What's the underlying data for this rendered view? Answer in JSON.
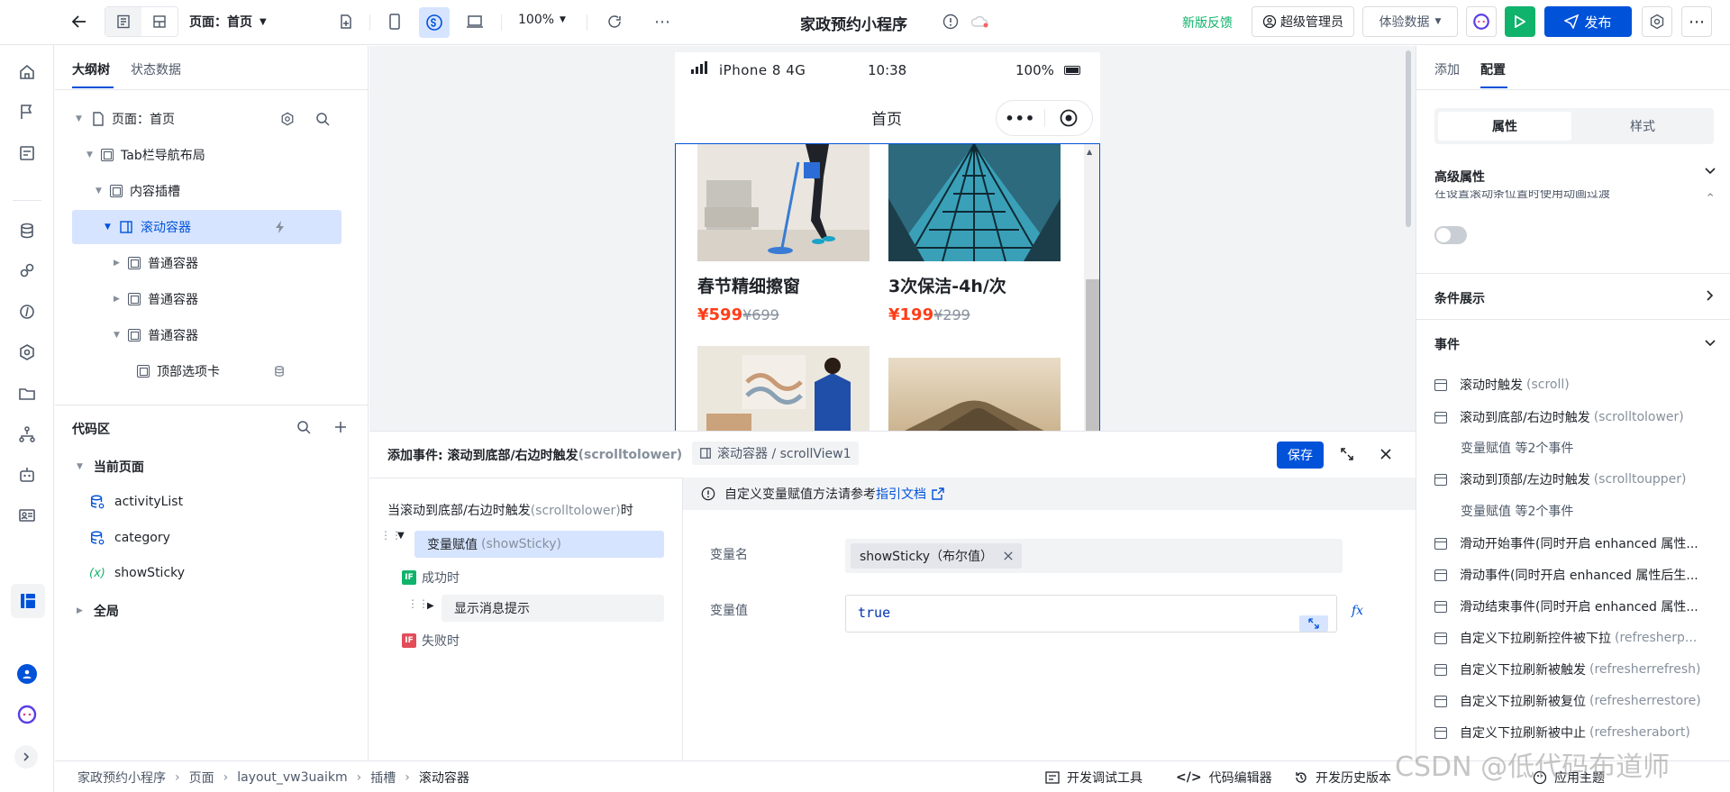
{
  "topbar": {
    "page_selector": "页面：首页",
    "zoom": "100%",
    "app_title": "家政预约小程序",
    "feedback": "新版反馈",
    "admin": "超级管理员",
    "data_mode": "体验数据",
    "publish": "发布"
  },
  "outline": {
    "tab_outline": "大纲树",
    "tab_state": "状态数据",
    "nodes": [
      {
        "label": "页面：首页"
      },
      {
        "label": "Tab栏导航布局"
      },
      {
        "label": "内容插槽"
      },
      {
        "label": "滚动容器"
      },
      {
        "label": "普通容器"
      },
      {
        "label": "普通容器"
      },
      {
        "label": "普通容器"
      },
      {
        "label": "顶部选项卡"
      }
    ]
  },
  "code": {
    "title": "代码区",
    "current_page": "当前页面",
    "items": [
      "activityList",
      "category",
      "showSticky"
    ],
    "global": "全局"
  },
  "phone": {
    "status_left": "iPhone 8  4G",
    "status_time": "10:38",
    "status_battery": "100%",
    "nav_title": "首页",
    "cards": [
      {
        "title": "春节精细擦窗",
        "price": "¥599",
        "old": "¥699"
      },
      {
        "title": "3次保洁-4h/次",
        "price": "¥199",
        "old": "¥299"
      }
    ]
  },
  "event_panel": {
    "title_prefix": "添加事件: 滚动到底部/右边时触发",
    "title_en": "(scrolltolower)",
    "target": "滚动容器 / scrollView1",
    "save": "保存",
    "trigger_prefix": "当滚动到底部/右边时触发",
    "trigger_en": "(scrolltolower)",
    "trigger_suffix": "时",
    "action_label": "变量赋值",
    "action_en": "(showSticky)",
    "success": "成功时",
    "message": "显示消息提示",
    "fail": "失败时",
    "tip": "自定义变量赋值方法请参考",
    "tip_link": "指引文档",
    "var_name_label": "变量名",
    "var_name_tag": "showSticky（布尔值）",
    "var_value_label": "变量值",
    "var_value": "true"
  },
  "config": {
    "tab_add": "添加",
    "tab_config": "配置",
    "seg_props": "属性",
    "seg_style": "样式",
    "advanced": "高级属性",
    "advanced_cut": "在设置滚动条位置时使用动画过渡",
    "conditional": "条件展示",
    "events": "事件",
    "event_list": [
      {
        "zh": "滚动时触发",
        "en": "(scroll)"
      },
      {
        "zh": "滚动到底部/右边时触发",
        "en": "(scrolltolower)"
      },
      {
        "zh": "滚动到顶部/左边时触发",
        "en": "(scrolltoupper)"
      },
      {
        "zh": "滑动开始事件(同时开启 enhanced 属性...",
        "en": ""
      },
      {
        "zh": "滑动事件(同时开启 enhanced 属性后生...",
        "en": ""
      },
      {
        "zh": "滑动结束事件(同时开启 enhanced 属性...",
        "en": ""
      },
      {
        "zh": "自定义下拉刷新控件被下拉",
        "en": "(refresherp..."
      },
      {
        "zh": "自定义下拉刷新被触发",
        "en": "(refresherrefresh)"
      },
      {
        "zh": "自定义下拉刷新被复位",
        "en": "(refresherrestore)"
      },
      {
        "zh": "自定义下拉刷新被中止",
        "en": "(refresherabort)"
      }
    ],
    "sub_assign": "变量赋值 等2个事件"
  },
  "footer": {
    "crumbs": [
      "家政预约小程序",
      "页面",
      "layout_vw3uaikm",
      "插槽",
      "滚动容器"
    ],
    "devtools": "开发调试工具",
    "code_editor": "代码编辑器",
    "history": "开发历史版本",
    "theme": "应用主题",
    "watermark": "CSDN @低代码布道师"
  },
  "colors": {
    "accent": "#0052d9",
    "price": "#ff3d17",
    "run": "#10b36b"
  }
}
